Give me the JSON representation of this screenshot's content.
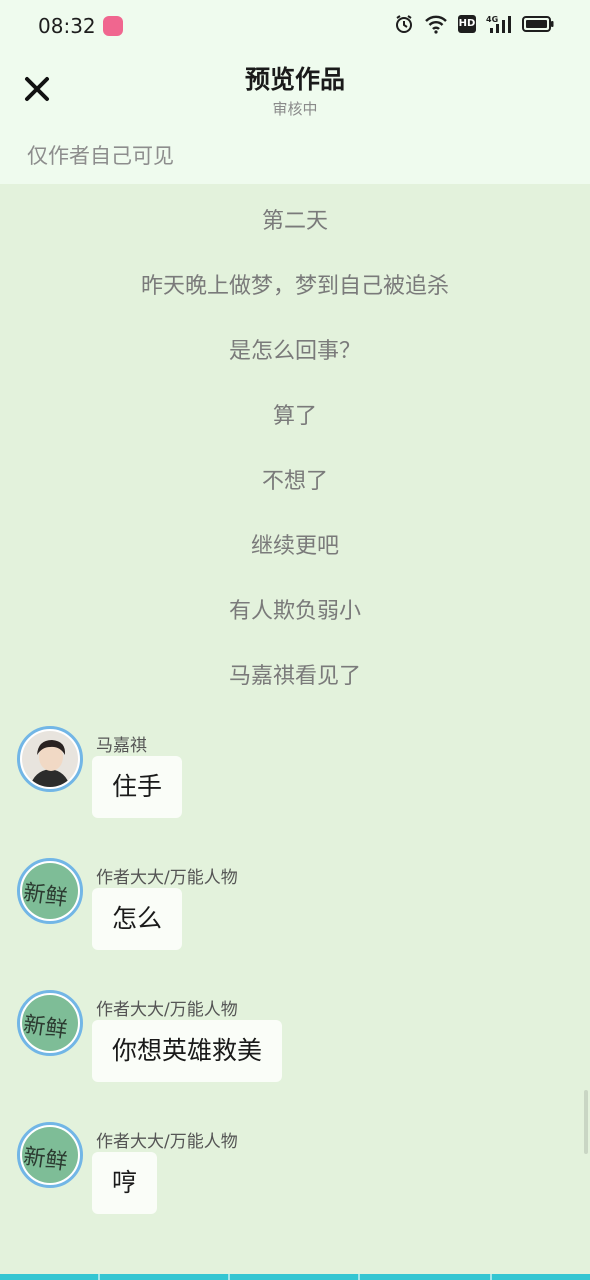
{
  "status_bar": {
    "time": "08:32",
    "hd_label": "HD",
    "network_label": "4G"
  },
  "header": {
    "title": "预览作品",
    "subtitle": "审核中",
    "visibility_note": "仅作者自己可见"
  },
  "narration": [
    "第二天",
    "昨天晚上做梦，梦到自己被追杀",
    "是怎么回事？",
    "算了",
    "不想了",
    "继续更吧",
    "有人欺负弱小",
    "马嘉祺看见了"
  ],
  "messages": [
    {
      "name": "马嘉祺",
      "text": "住手",
      "avatar": "character-photo-avatar"
    },
    {
      "name": "作者大大/万能人物",
      "text": "怎么",
      "avatar": "author-avatar"
    },
    {
      "name": "作者大大/万能人物",
      "text": "你想英雄救美",
      "avatar": "author-avatar"
    },
    {
      "name": "作者大大/万能人物",
      "text": "哼",
      "avatar": "author-avatar"
    }
  ],
  "avatar_text": "新鲜",
  "colors": {
    "background": "#e3f2dc",
    "header_background": "#effbee",
    "avatar_border": "#72b6e6",
    "author_avatar": "#7ebd97",
    "bubble": "#fafdf8",
    "bottom_strip": "#34c6d2"
  }
}
